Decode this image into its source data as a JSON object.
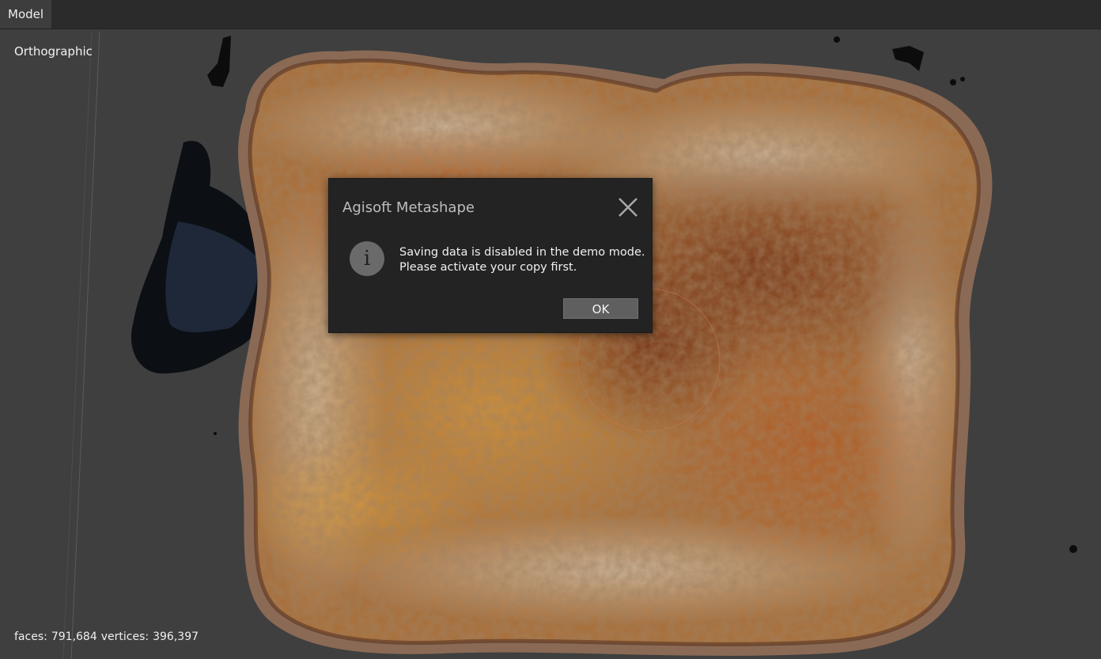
{
  "tabs": [
    {
      "label": "Model",
      "active": true
    }
  ],
  "viewport": {
    "projection_label": "Orthographic",
    "stats": {
      "faces_label": "faces:",
      "faces_value": "791,684",
      "vertices_label": "vertices:",
      "vertices_value": "396,397"
    },
    "background_color": "#3f3f3f"
  },
  "dialog": {
    "title": "Agisoft Metashape",
    "icon": "info-icon",
    "message_line1": "Saving data is disabled in the demo mode.",
    "message_line2": "Please activate your copy first.",
    "ok_label": "OK",
    "close_icon": "close-icon"
  },
  "colors": {
    "toast_crust": "#a36a3a",
    "toast_light": "#c9b08a",
    "toast_burn": "#8a3a1a",
    "dialog_bg": "#232323"
  }
}
